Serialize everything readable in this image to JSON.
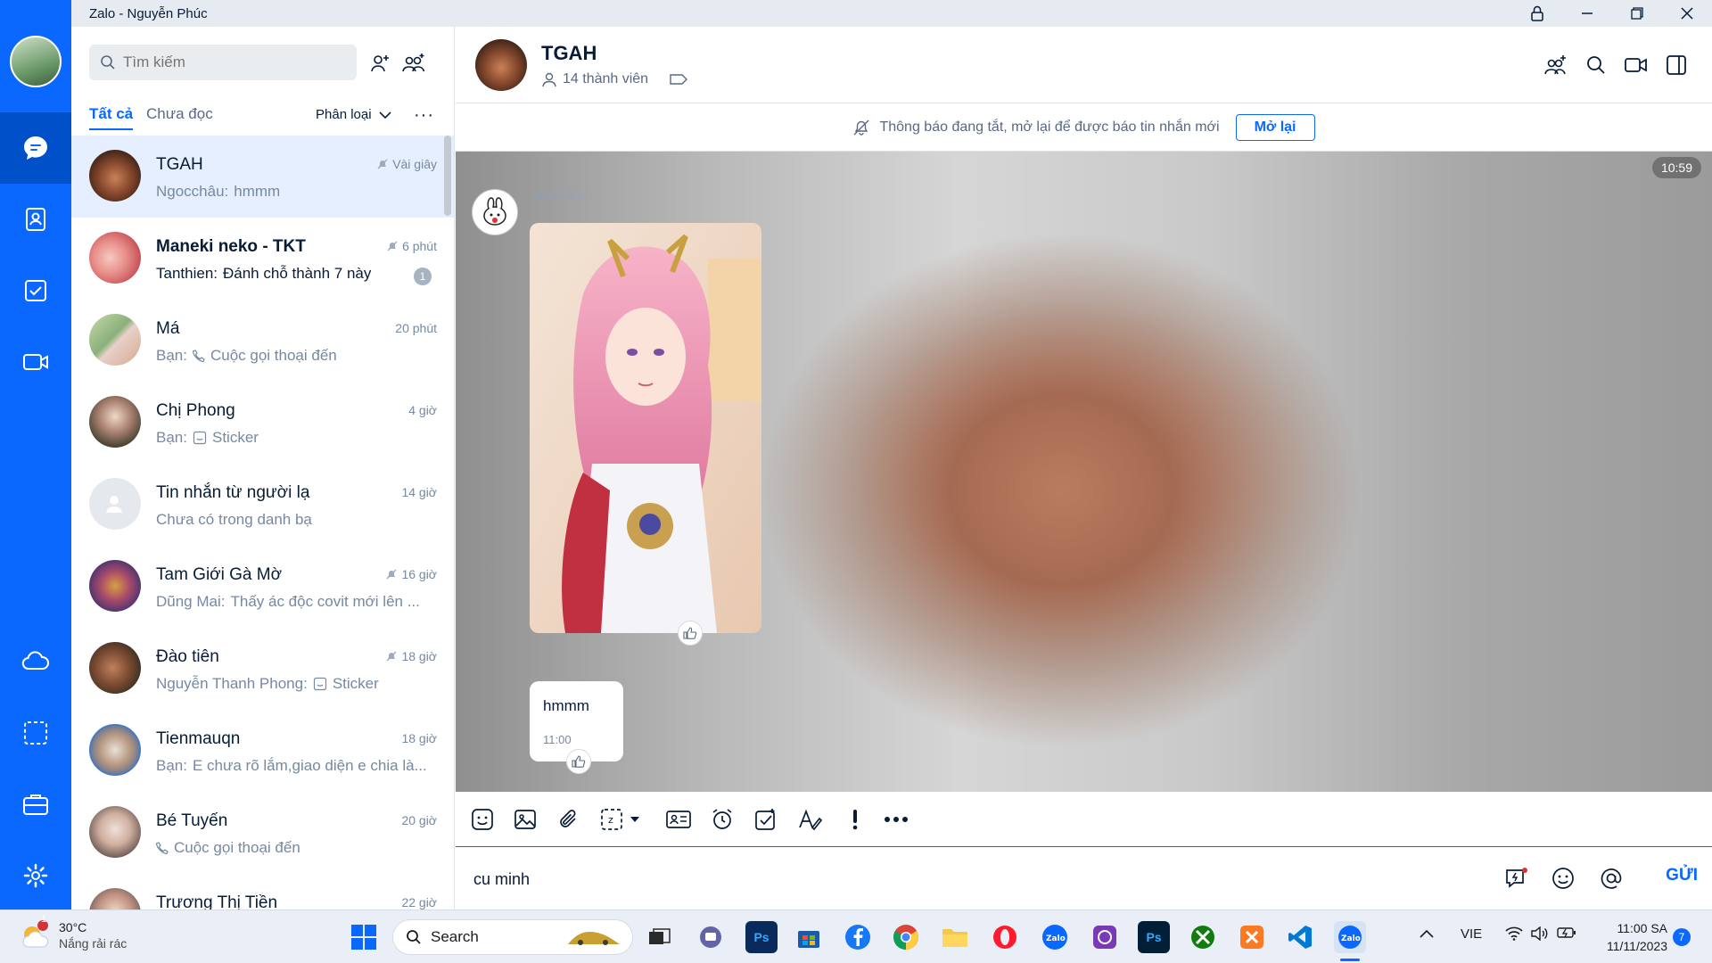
{
  "window": {
    "title": "Zalo - Nguyễn Phúc"
  },
  "search": {
    "placeholder": "Tìm kiếm"
  },
  "filters": {
    "all": "Tất cả",
    "unread": "Chưa đọc",
    "classify": "Phân loại",
    "more": "···"
  },
  "conversations": [
    {
      "name": "TGAH",
      "time": "Vài giây",
      "muted": true,
      "prefix": "Ngocchâu:",
      "message": "hmmm",
      "active": true
    },
    {
      "name": "Maneki neko - TKT",
      "time": "6 phút",
      "muted": true,
      "prefix": "Tanthien:",
      "message": "Đánh chỗ thành 7 này",
      "unread": "1",
      "bold": true
    },
    {
      "name": "Má",
      "time": "20 phút",
      "prefix": "Bạn:",
      "message": "Cuộc gọi thoại đến",
      "icon": "phone-icon"
    },
    {
      "name": "Chị Phong",
      "time": "4 giờ",
      "prefix": "Bạn:",
      "message": "Sticker",
      "icon": "sticker-icon"
    },
    {
      "name": "Tin nhắn từ người lạ",
      "time": "14 giờ",
      "prefix": "",
      "message": "Chưa có trong danh bạ"
    },
    {
      "name": "Tam Giới Gà Mờ",
      "time": "16 giờ",
      "muted": true,
      "prefix": "Dũng Mai:",
      "message": "Thấy ác độc covit mới lên ..."
    },
    {
      "name": "Đào tiên",
      "time": "18 giờ",
      "muted": true,
      "prefix": "Nguyễn Thanh Phong:",
      "message": "Sticker",
      "icon": "sticker-icon"
    },
    {
      "name": "Tienmauqn",
      "time": "18 giờ",
      "prefix": "Bạn:",
      "message": "E chưa rõ lắm,giao diện e chia là..."
    },
    {
      "name": "Bé Tuyến",
      "time": "20 giờ",
      "prefix": "",
      "message": "Cuộc gọi thoại đến",
      "icon": "phone-icon"
    },
    {
      "name": "Trương Thị Tiền",
      "time": "22 giờ",
      "prefix": "",
      "message": ""
    }
  ],
  "chat": {
    "name": "TGAH",
    "members": "14 thành viên",
    "notice": "Thông báo đang tắt, mở lại để được báo tin nhắn mới",
    "notice_button": "Mở lại",
    "timestamp": "10:59",
    "sender": "Ngocchâu",
    "message_text": "hmmm",
    "message_time": "11:00"
  },
  "composer": {
    "value": "cu minh",
    "send": "GỬI"
  },
  "taskbar": {
    "weather_temp": "30°C",
    "weather_desc": "Nắng rải rác",
    "weather_badge": "1",
    "search": "Search",
    "lang": "VIE",
    "time": "11:00 SA",
    "date": "11/11/2023",
    "notif": "7"
  },
  "colors": {
    "accent": "#0a68ff",
    "rail": "#0a68ff",
    "active_row": "#e5efff"
  }
}
